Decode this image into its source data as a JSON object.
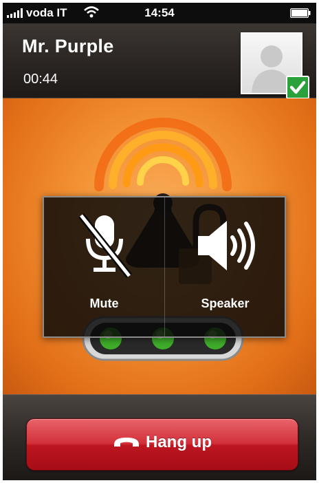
{
  "status_bar": {
    "carrier": "voda IT",
    "time": "14:54",
    "icons": [
      "signal-bars-icon",
      "wifi-icon",
      "battery-icon"
    ]
  },
  "call": {
    "caller_name": "Mr. Purple",
    "duration": "00:44",
    "caller_verified": true
  },
  "controls": {
    "mute_label": "Mute",
    "speaker_label": "Speaker"
  },
  "hangup": {
    "label": "Hang up",
    "icon": "phone-hangup-icon"
  },
  "colors": {
    "stage_orange": "#f39234",
    "hangup_red": "#c21a24",
    "verified_green": "#2aa13a",
    "led_green": "#3fae2a"
  }
}
